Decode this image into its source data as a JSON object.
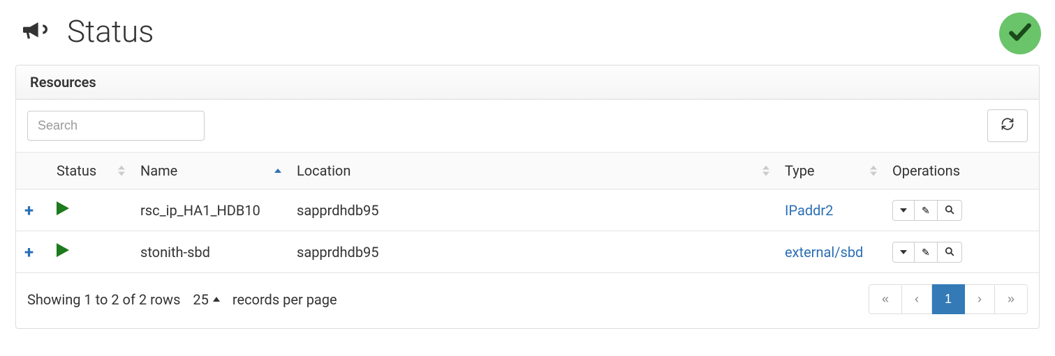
{
  "header": {
    "title": "Status"
  },
  "panel": {
    "title": "Resources"
  },
  "search": {
    "placeholder": "Search"
  },
  "columns": {
    "status": "Status",
    "name": "Name",
    "location": "Location",
    "type": "Type",
    "operations": "Operations"
  },
  "rows": [
    {
      "name": "rsc_ip_HA1_HDB10",
      "location": "sapprdhdb95",
      "type": "IPaddr2"
    },
    {
      "name": "stonith-sbd",
      "location": "sapprdhdb95",
      "type": "external/sbd"
    }
  ],
  "footer": {
    "summary": "Showing 1 to 2 of 2 rows",
    "page_size": "25",
    "records_label": "records per page"
  },
  "pagination": {
    "first": "«",
    "prev": "‹",
    "current": "1",
    "next": "›",
    "last": "»"
  }
}
